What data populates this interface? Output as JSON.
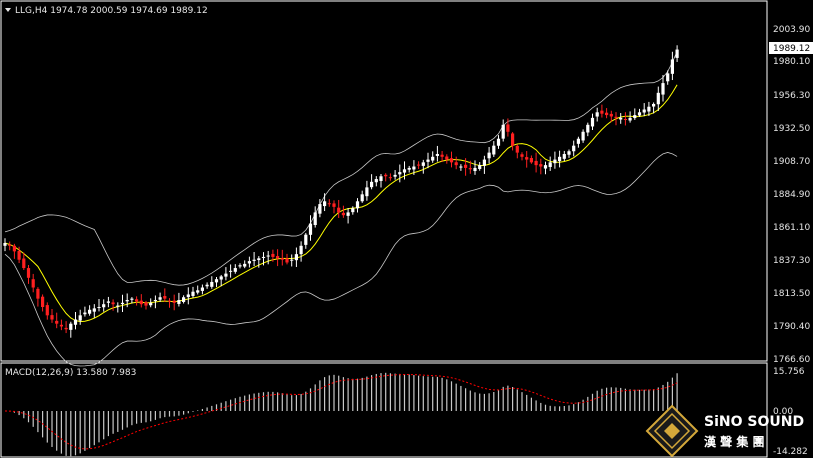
{
  "header": {
    "dropdown_icon": "triangle-down-icon",
    "text": "LLG,H4  1974.78 2000.59 1974.69 1989.12"
  },
  "price_axis": {
    "ticks": [
      "2003.90",
      "1980.10",
      "1956.30",
      "1932.50",
      "1908.70",
      "1884.90",
      "1861.10",
      "1837.30",
      "1813.50",
      "1790.40",
      "1766.60"
    ],
    "current_price": "1989.12"
  },
  "macd": {
    "label": "MACD(12,26,9) 13.580 7.983",
    "ticks": [
      "15.756",
      "0.00",
      "-14.282"
    ]
  },
  "logo": {
    "text_en": "SiNO SOUND",
    "text_cn": "漢 聲 集 團"
  },
  "colors": {
    "background": "#000000",
    "bull_candle": "#ffffff",
    "bear_candle": "#ff2020",
    "bollinger": "#c8c8c8",
    "moving_average": "#ffff00",
    "macd_histogram": "#c8c8c8",
    "macd_signal": "#ff0000",
    "logo_gold": "#d4a83a"
  },
  "chart_data": {
    "type": "candlestick",
    "symbol": "LLG",
    "timeframe": "H4",
    "closes": [
      1850,
      1848,
      1844,
      1838,
      1832,
      1825,
      1818,
      1810,
      1804,
      1798,
      1795,
      1792,
      1790,
      1788,
      1792,
      1795,
      1798,
      1800,
      1802,
      1803,
      1804,
      1806,
      1808,
      1806,
      1805,
      1807,
      1809,
      1810,
      1808,
      1806,
      1805,
      1807,
      1809,
      1811,
      1810,
      1808,
      1807,
      1809,
      1811,
      1813,
      1815,
      1816,
      1818,
      1820,
      1822,
      1824,
      1826,
      1828,
      1830,
      1832,
      1834,
      1835,
      1837,
      1838,
      1839,
      1840,
      1841,
      1840,
      1839,
      1838,
      1836,
      1838,
      1842,
      1848,
      1856,
      1864,
      1872,
      1878,
      1880,
      1878,
      1876,
      1872,
      1870,
      1872,
      1875,
      1880,
      1885,
      1890,
      1894,
      1896,
      1898,
      1898,
      1897,
      1899,
      1901,
      1903,
      1904,
      1905,
      1906,
      1908,
      1910,
      1912,
      1914,
      1912,
      1910,
      1908,
      1906,
      1905,
      1904,
      1903,
      1904,
      1906,
      1910,
      1915,
      1920,
      1925,
      1935,
      1930,
      1920,
      1915,
      1912,
      1910,
      1908,
      1906,
      1905,
      1906,
      1908,
      1910,
      1912,
      1914,
      1916,
      1920,
      1925,
      1930,
      1935,
      1940,
      1944,
      1943,
      1942,
      1941,
      1940,
      1940,
      1939,
      1940,
      1942,
      1944,
      1946,
      1948,
      1950,
      1958,
      1965,
      1972,
      1982,
      1989.12
    ]
  }
}
